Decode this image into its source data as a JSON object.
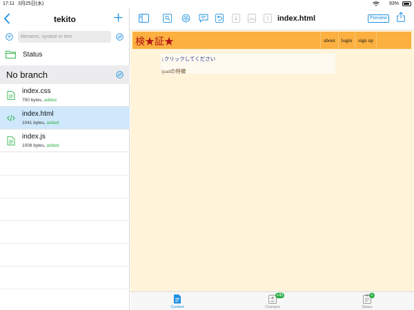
{
  "status_bar": {
    "time": "17:11",
    "date": "3月25日(水)",
    "battery_percent": "93%",
    "battery_level": 0.93
  },
  "sidebar": {
    "title": "tekito",
    "search": {
      "placeholder": "filename, symbol or text",
      "value": ""
    },
    "status_label": "Status",
    "branch_label": "No branch",
    "files": [
      {
        "name": "index.css",
        "size": "750 bytes,",
        "state": "added",
        "icon": "file-text-icon",
        "selected": false
      },
      {
        "name": "index.html",
        "size": "1041 bytes,",
        "state": "added",
        "icon": "code-icon",
        "selected": true
      },
      {
        "name": "index.js",
        "size": "1008 bytes,",
        "state": "added",
        "icon": "file-text-icon",
        "selected": false
      }
    ]
  },
  "editor": {
    "document_title": "index.html",
    "preview_label": "Preview",
    "toolbar_icons": [
      "sidebar-toggle-icon",
      "image-search-icon",
      "fingerprint-icon",
      "comment-icon",
      "undo-icon",
      "download-icon",
      "image-icon",
      "info-icon"
    ]
  },
  "preview_page": {
    "logo": "検★証★",
    "nav": [
      "about",
      "login",
      "sign up"
    ],
    "click_text": "↓クリックしてください",
    "feature_text": "ipadの特徴"
  },
  "tabbar": {
    "tabs": [
      {
        "label": "Content",
        "active": true,
        "badge": ""
      },
      {
        "label": "Changes",
        "active": false,
        "badge": "+42"
      },
      {
        "label": "Status",
        "active": false,
        "badge": "+"
      }
    ]
  },
  "colors": {
    "accent": "#1a8fe0",
    "added": "#30b14a",
    "selected_row": "#cfe8fb",
    "preview_bg": "#fff3d9",
    "site_header": "#fbb040",
    "site_logo": "#b01414"
  }
}
